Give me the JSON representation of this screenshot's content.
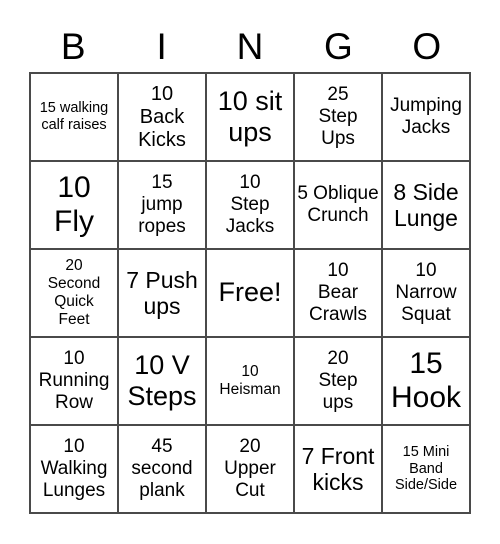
{
  "header": {
    "letters": [
      "B",
      "I",
      "N",
      "G",
      "O"
    ]
  },
  "cells": [
    [
      "15 walking calf raises",
      "10 Back Kicks",
      "10 sit ups",
      "25 Step Ups",
      "Jumping Jacks"
    ],
    [
      "10 Fly",
      "15 jump ropes",
      "10 Step Jacks",
      "5 Oblique Crunch",
      "8 Side Lunge"
    ],
    [
      "20 Second Quick Feet",
      "7 Push ups",
      "Free!",
      "10 Bear Crawls",
      "10 Narrow Squat"
    ],
    [
      "10 Running Row",
      "10 V Steps",
      "10 Heisman",
      "20 Step ups",
      "15 Hook"
    ],
    [
      "10 Walking Lunges",
      "45 second plank",
      "20 Upper Cut",
      "7 Front kicks",
      "15 Mini Band Side/Side"
    ]
  ]
}
